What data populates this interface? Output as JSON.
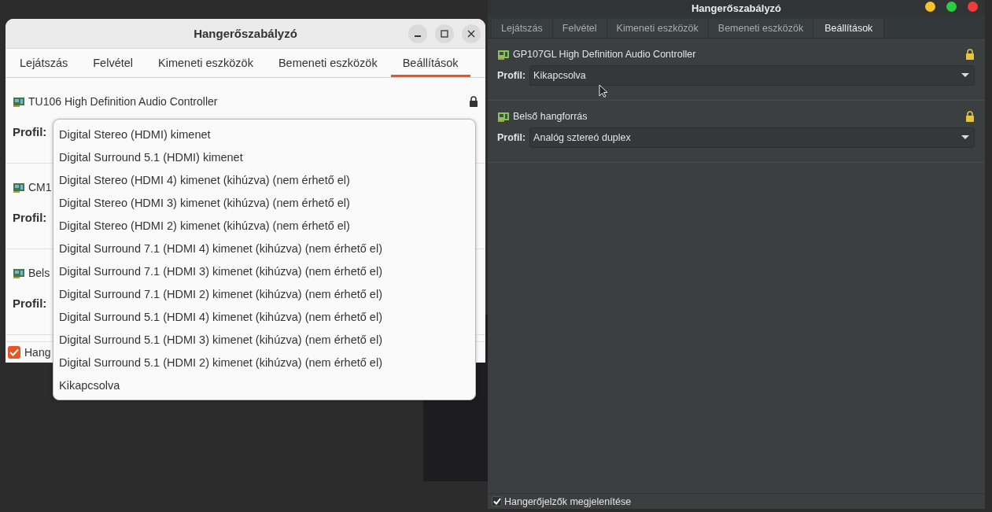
{
  "left_window": {
    "title": "Hangerőszabályzó",
    "tabs": [
      {
        "label": "Lejátszás",
        "selected": false
      },
      {
        "label": "Felvétel",
        "selected": false
      },
      {
        "label": "Kimeneti eszközök",
        "selected": false
      },
      {
        "label": "Bemeneti eszközök",
        "selected": false
      },
      {
        "label": "Beállítások",
        "selected": true
      }
    ],
    "cards": [
      {
        "name": "TU106 High Definition Audio Controller",
        "locked": true,
        "profile_label": "Profil:"
      },
      {
        "name": "CM1",
        "locked": false,
        "profile_label": "Profil:"
      },
      {
        "name": "Bels",
        "locked": false,
        "profile_label": "Profil:"
      }
    ],
    "footer_checkbox": {
      "label": "Hang",
      "checked": true
    }
  },
  "profile_menu": {
    "items": [
      "Digital Stereo (HDMI) kimenet",
      "Digital Surround 5.1 (HDMI) kimenet",
      "Digital Stereo (HDMI 4) kimenet (kihúzva) (nem érhető el)",
      "Digital Stereo (HDMI 3) kimenet (kihúzva) (nem érhető el)",
      "Digital Stereo (HDMI 2) kimenet (kihúzva) (nem érhető el)",
      "Digital Surround 7.1 (HDMI 4) kimenet (kihúzva) (nem érhető el)",
      "Digital Surround 7.1 (HDMI 3) kimenet (kihúzva) (nem érhető el)",
      "Digital Surround 7.1 (HDMI 2) kimenet (kihúzva) (nem érhető el)",
      "Digital Surround 5.1 (HDMI 4) kimenet (kihúzva) (nem érhető el)",
      "Digital Surround 5.1 (HDMI 3) kimenet (kihúzva) (nem érhető el)",
      "Digital Surround 5.1 (HDMI 2) kimenet (kihúzva) (nem érhető el)",
      "Kikapcsolva"
    ]
  },
  "right_window": {
    "title": "Hangerőszabályzó",
    "tabs": [
      {
        "label": "Lejátszás",
        "selected": false
      },
      {
        "label": "Felvétel",
        "selected": false
      },
      {
        "label": "Kimeneti eszközök",
        "selected": false
      },
      {
        "label": "Bemeneti eszközök",
        "selected": false
      },
      {
        "label": "Beállítások",
        "selected": true
      }
    ],
    "cards": [
      {
        "name": "GP107GL High Definition Audio Controller",
        "locked": true,
        "profile_label": "Profil:",
        "profile": "Kikapcsolva"
      },
      {
        "name": "Belső hangforrás",
        "locked": true,
        "profile_label": "Profil:",
        "profile": "Analóg sztereó duplex"
      }
    ],
    "footer_checkbox": {
      "label": "Hangerőjelzők megjelenítése",
      "checked": true
    }
  }
}
